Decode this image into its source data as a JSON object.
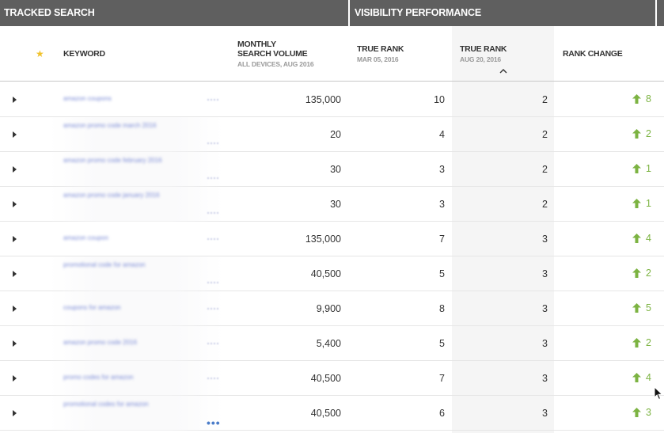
{
  "header_groups": {
    "tracked": "TRACKED SEARCH",
    "visibility": "VISIBILITY PERFORMANCE",
    "extra": ""
  },
  "columns": {
    "keyword": "KEYWORD",
    "volume_title_1": "MONTHLY",
    "volume_title_2": "SEARCH VOLUME",
    "volume_sub": "ALL DEVICES, AUG 2016",
    "rank1_title": "TRUE RANK",
    "rank1_sub": "MAR 05, 2016",
    "rank2_title": "TRUE RANK",
    "rank2_sub": "AUG 20, 2016",
    "change_title": "RANK CHANGE"
  },
  "icons": {
    "star": "star-icon",
    "expand": "caret-right-icon",
    "sort": "chevron-up-icon",
    "up": "arrow-up-icon"
  },
  "colors": {
    "header_bg": "#5f5f5f",
    "star": "#f0c22c",
    "positive": "#7cb342",
    "highlight_col": "#f5f5f5"
  },
  "rows": [
    {
      "keyword": "amazon coupons",
      "volume": "135,000",
      "rank_mar": "10",
      "rank_aug": "2",
      "change": "8"
    },
    {
      "keyword": "amazon promo code march 2016",
      "volume": "20",
      "rank_mar": "4",
      "rank_aug": "2",
      "change": "2"
    },
    {
      "keyword": "amazon promo code february 2016",
      "volume": "30",
      "rank_mar": "3",
      "rank_aug": "2",
      "change": "1"
    },
    {
      "keyword": "amazon promo code january 2016",
      "volume": "30",
      "rank_mar": "3",
      "rank_aug": "2",
      "change": "1"
    },
    {
      "keyword": "amazon coupon",
      "volume": "135,000",
      "rank_mar": "7",
      "rank_aug": "3",
      "change": "4"
    },
    {
      "keyword": "promotional code for amazon",
      "volume": "40,500",
      "rank_mar": "5",
      "rank_aug": "3",
      "change": "2"
    },
    {
      "keyword": "coupons for amazon",
      "volume": "9,900",
      "rank_mar": "8",
      "rank_aug": "3",
      "change": "5"
    },
    {
      "keyword": "amazon promo code 2016",
      "volume": "5,400",
      "rank_mar": "5",
      "rank_aug": "3",
      "change": "2"
    },
    {
      "keyword": "promo codes for amazon",
      "volume": "40,500",
      "rank_mar": "7",
      "rank_aug": "3",
      "change": "4"
    },
    {
      "keyword": "promotional codes for amazon",
      "volume": "40,500",
      "rank_mar": "6",
      "rank_aug": "3",
      "change": "3"
    }
  ],
  "more_label": "•••"
}
